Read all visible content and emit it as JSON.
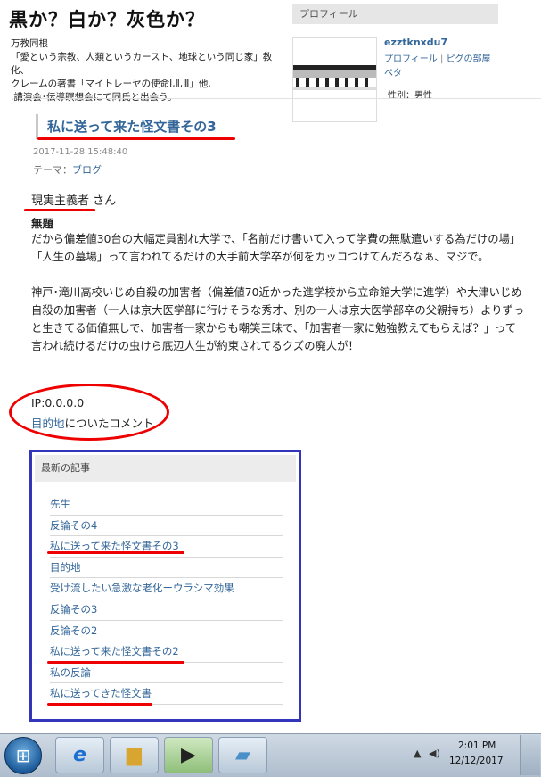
{
  "blog": {
    "title": "黒か？白か？灰色か？",
    "description": [
      "万教同根",
      "「愛という宗教、人類というカースト、地球という同じ家」教化、",
      "クレームの著書「マイトレーヤの使命Ⅰ,Ⅱ,Ⅲ」他.",
      ".講演会･伝導瞑想会にて同氏と出会う。"
    ]
  },
  "profile": {
    "heading": "プロフィール",
    "username": "ezztknxdu7",
    "links": [
      "プロフィール",
      "ピグの部屋",
      "ペタ"
    ],
    "separator": "|",
    "gender": "性別：男性"
  },
  "entry": {
    "title": "私に送って来た怪文書その3",
    "date": "2017-11-28 15:48:40",
    "theme_label": "テーマ：",
    "theme_link": "ブログ"
  },
  "comment": {
    "author": "現実主義者",
    "author_suffix": " さん",
    "subject": "無題",
    "paragraph1": "だから偏差値30台の大幅定員割れ大学で、「名前だけ書いて入って学費の無駄遣いする為だけの場」「人生の墓場」って言われてるだけの大手前大学卒が何をカッコつけてんだろなぁ、マジで。",
    "paragraph2": "神戸･滝川高校いじめ自殺の加害者（偏差値70近かった進学校から立命館大学に進学）や大津いじめ自殺の加害者（一人は京大医学部に行けそうな秀才、別の一人は京大医学部卒の父親持ち）よりずっと生きてる価値無しで、加害者一家からも嘲笑三昧で、「加害者一家に勉強教えてもらえば？」って言われ続けるだけの虫けら底辺人生が約束されてるクズの廃人が！",
    "ip": "IP:0.0.0.0",
    "target_link": "目的地",
    "target_suffix": "についたコメント"
  },
  "recent": {
    "heading": "最新の記事",
    "items": [
      "先生",
      "反論その4",
      "私に送って来た怪文書その3",
      "目的地",
      "受け流したい急激な老化ーウラシマ効果",
      "反論その3",
      "反論その2",
      "私に送って来た怪文書その2",
      "私の反論",
      "私に送ってきた怪文書"
    ]
  },
  "taskbar": {
    "time": "2:01 PM",
    "date": "12/12/2017",
    "apps": [
      "ie-icon",
      "explorer-icon",
      "media-icon",
      "notepad-icon"
    ]
  },
  "colors": {
    "link": "#336699",
    "annotation_red": "#e00000",
    "annotation_blue": "#3333bb"
  }
}
